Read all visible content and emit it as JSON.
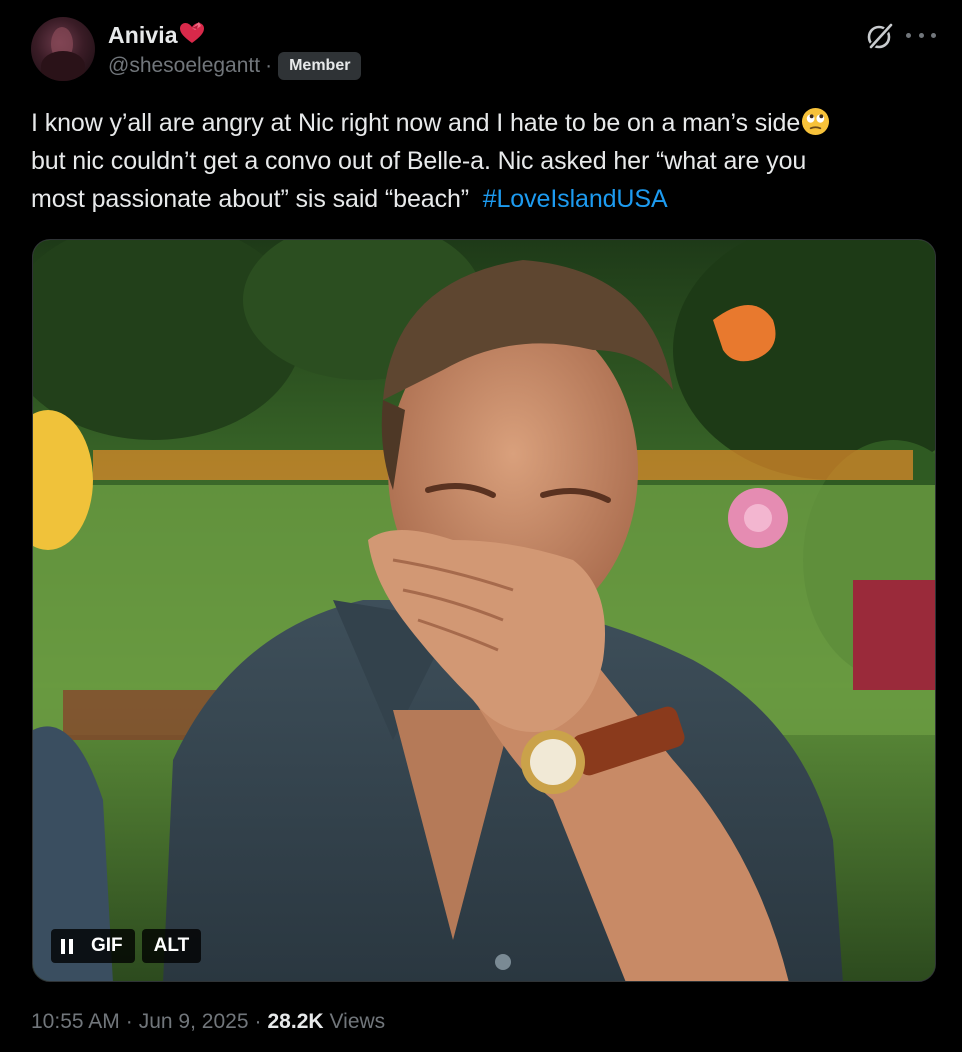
{
  "author": {
    "display_name": "Anivia",
    "handle": "@shesoelegantt",
    "separator": "·",
    "badge": "Member",
    "avatar_icon": "avatar-photo",
    "name_emoji": "heart-with-ribbon-icon"
  },
  "actions": {
    "grok_icon": "grok-icon",
    "more_icon": "more-icon"
  },
  "text": {
    "line1": "I know y’all are angry at Nic right now and I hate to be on a man’s side",
    "line1_emoji": "face-with-rolling-eyes-icon",
    "line2": "but nic couldn’t get a convo out of Belle-a. Nic asked her “what are you",
    "line3": "most passionate about” sis said “beach”",
    "hashtag": "#LoveIslandUSA"
  },
  "media": {
    "type": "GIF",
    "pause_icon": "pause-icon",
    "gif_label": "GIF",
    "alt_label": "ALT"
  },
  "meta": {
    "time": "10:55 AM",
    "sep1": "·",
    "date": "Jun 9, 2025",
    "sep2": "·",
    "views_count": "28.2K",
    "views_label": "Views"
  },
  "colors": {
    "background": "#000000",
    "text": "#e7e9ea",
    "muted": "#71767b",
    "link": "#1d9bf0",
    "badge_bg": "#2f3336"
  }
}
